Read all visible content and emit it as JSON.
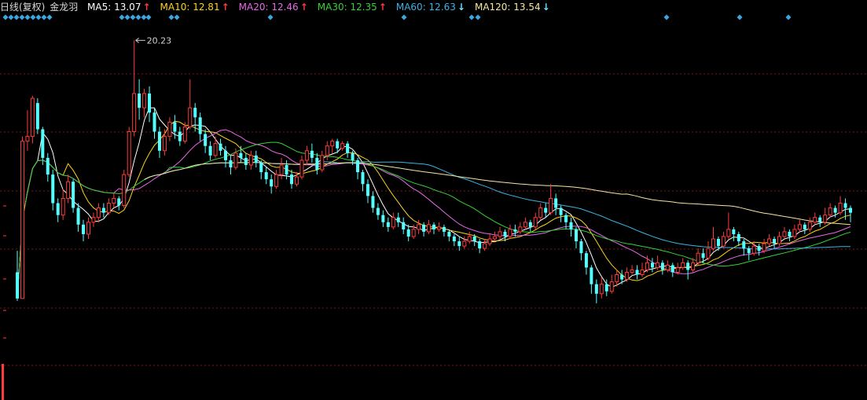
{
  "header": {
    "period_label": "日线(复权)",
    "stock_name": "金龙羽",
    "ma": [
      {
        "label": "MA5",
        "value": "13.07",
        "arrow": "↑",
        "arrow_color": "#ff3b3b",
        "color": "#ffffff"
      },
      {
        "label": "MA10",
        "value": "12.81",
        "arrow": "↑",
        "arrow_color": "#ff3b3b",
        "color": "#ffd21a"
      },
      {
        "label": "MA20",
        "value": "12.46",
        "arrow": "↑",
        "arrow_color": "#ff3b3b",
        "color": "#e868e8"
      },
      {
        "label": "MA30",
        "value": "12.35",
        "arrow": "↑",
        "arrow_color": "#ff3b3b",
        "color": "#36d236"
      },
      {
        "label": "MA60",
        "value": "12.63",
        "arrow": "↓",
        "arrow_color": "#66e0ff",
        "color": "#39b4e6"
      },
      {
        "label": "MA120",
        "value": "13.54",
        "arrow": "↓",
        "arrow_color": "#66e0ff",
        "color": "#f5e6a0"
      }
    ]
  },
  "colors": {
    "up": "#ff3b3b",
    "down": "#54ffff",
    "grid": "#7a1a1a",
    "marker": "#3aa7e0"
  },
  "chart_data": {
    "type": "candlestick",
    "annotation": {
      "text": "20.23",
      "value": 20.23
    },
    "ylim": [
      8.9,
      21.0
    ],
    "grid": true,
    "candles": [
      [
        10.5,
        9.4,
        11.4,
        9.3
      ],
      [
        9.4,
        16.0,
        16.2,
        9.4
      ],
      [
        16.0,
        16.2,
        17.3,
        15.6
      ],
      [
        16.2,
        17.8,
        17.9,
        15.9
      ],
      [
        17.6,
        16.5,
        17.8,
        16.3
      ],
      [
        16.5,
        15.3,
        16.6,
        15.0
      ],
      [
        15.3,
        14.6,
        15.5,
        14.3
      ],
      [
        14.6,
        13.4,
        14.8,
        13.1
      ],
      [
        13.4,
        12.9,
        13.6,
        12.6
      ],
      [
        12.9,
        13.6,
        14.0,
        12.7
      ],
      [
        13.6,
        14.3,
        14.6,
        13.4
      ],
      [
        14.3,
        13.2,
        14.4,
        13.0
      ],
      [
        13.2,
        12.5,
        13.4,
        12.2
      ],
      [
        12.5,
        12.1,
        12.7,
        11.8
      ],
      [
        12.1,
        12.6,
        12.8,
        11.9
      ],
      [
        12.6,
        12.8,
        13.0,
        12.4
      ],
      [
        12.8,
        13.2,
        13.4,
        12.6
      ],
      [
        13.2,
        13.0,
        13.4,
        12.8
      ],
      [
        13.0,
        13.4,
        13.6,
        12.9
      ],
      [
        13.4,
        13.6,
        13.8,
        13.2
      ],
      [
        13.6,
        13.3,
        13.7,
        13.1
      ],
      [
        13.3,
        14.6,
        14.8,
        13.2
      ],
      [
        14.6,
        16.4,
        16.6,
        14.5
      ],
      [
        16.4,
        18.0,
        20.23,
        16.2
      ],
      [
        18.0,
        17.4,
        18.6,
        16.9
      ],
      [
        17.4,
        18.0,
        18.2,
        17.0
      ],
      [
        18.0,
        17.2,
        18.3,
        16.8
      ],
      [
        17.2,
        16.4,
        17.4,
        16.1
      ],
      [
        16.4,
        15.6,
        16.6,
        15.3
      ],
      [
        15.6,
        16.2,
        16.5,
        15.4
      ],
      [
        16.2,
        16.8,
        17.0,
        16.0
      ],
      [
        16.8,
        16.4,
        17.1,
        16.1
      ],
      [
        16.4,
        16.0,
        16.6,
        15.8
      ],
      [
        16.0,
        16.6,
        16.8,
        15.9
      ],
      [
        16.6,
        17.4,
        18.6,
        16.5
      ],
      [
        17.4,
        17.0,
        17.6,
        16.4
      ],
      [
        17.0,
        16.3,
        17.2,
        16.0
      ],
      [
        16.3,
        15.8,
        16.5,
        15.5
      ],
      [
        15.8,
        15.4,
        16.0,
        15.2
      ],
      [
        15.4,
        15.9,
        16.2,
        15.3
      ],
      [
        15.9,
        15.6,
        16.1,
        15.4
      ],
      [
        15.6,
        15.2,
        15.8,
        14.9
      ],
      [
        15.2,
        14.9,
        15.4,
        14.6
      ],
      [
        14.9,
        15.5,
        15.7,
        14.8
      ],
      [
        15.5,
        15.3,
        15.8,
        15.1
      ],
      [
        15.3,
        15.0,
        15.5,
        14.8
      ],
      [
        15.0,
        15.4,
        15.6,
        14.8
      ],
      [
        15.4,
        15.1,
        15.6,
        14.9
      ],
      [
        15.1,
        14.7,
        15.2,
        14.4
      ],
      [
        14.7,
        14.4,
        14.9,
        14.2
      ],
      [
        14.4,
        14.1,
        14.6,
        13.8
      ],
      [
        14.1,
        14.6,
        14.8,
        14.0
      ],
      [
        14.6,
        15.0,
        15.3,
        14.4
      ],
      [
        15.0,
        14.6,
        15.2,
        14.4
      ],
      [
        14.6,
        14.2,
        14.8,
        14.0
      ],
      [
        14.2,
        14.5,
        14.7,
        14.1
      ],
      [
        14.5,
        15.2,
        15.4,
        14.4
      ],
      [
        15.2,
        15.6,
        15.8,
        15.0
      ],
      [
        15.6,
        15.3,
        15.9,
        15.1
      ],
      [
        15.3,
        14.8,
        15.5,
        14.6
      ],
      [
        14.8,
        15.4,
        15.6,
        14.7
      ],
      [
        15.4,
        15.8,
        16.0,
        15.2
      ],
      [
        15.8,
        16.0,
        16.1,
        15.5
      ],
      [
        16.0,
        15.7,
        16.1,
        15.5
      ],
      [
        15.7,
        15.9,
        16.0,
        15.6
      ],
      [
        15.9,
        15.5,
        16.0,
        15.3
      ],
      [
        15.5,
        15.2,
        15.6,
        15.0
      ],
      [
        15.2,
        14.7,
        15.3,
        14.4
      ],
      [
        14.7,
        14.2,
        14.8,
        13.9
      ],
      [
        14.2,
        13.7,
        14.4,
        13.4
      ],
      [
        13.7,
        13.2,
        13.9,
        13.0
      ],
      [
        13.2,
        12.9,
        13.4,
        12.7
      ],
      [
        12.9,
        12.6,
        13.1,
        12.4
      ],
      [
        12.6,
        12.4,
        12.8,
        12.2
      ],
      [
        12.4,
        12.8,
        13.0,
        12.3
      ],
      [
        12.8,
        12.6,
        13.0,
        12.4
      ],
      [
        12.6,
        12.3,
        12.8,
        12.1
      ],
      [
        12.3,
        12.0,
        12.5,
        11.8
      ],
      [
        12.0,
        12.3,
        12.5,
        11.9
      ],
      [
        12.3,
        12.5,
        12.7,
        12.1
      ],
      [
        12.5,
        12.2,
        12.6,
        12.0
      ],
      [
        12.2,
        12.5,
        12.7,
        12.1
      ],
      [
        12.5,
        12.3,
        12.6,
        12.1
      ],
      [
        12.3,
        12.4,
        12.6,
        12.2
      ],
      [
        12.4,
        12.2,
        12.5,
        12.0
      ],
      [
        12.2,
        12.0,
        12.3,
        11.8
      ],
      [
        12.0,
        11.8,
        12.1,
        11.6
      ],
      [
        11.8,
        11.6,
        12.0,
        11.4
      ],
      [
        11.6,
        11.8,
        12.0,
        11.5
      ],
      [
        11.8,
        12.0,
        12.2,
        11.7
      ],
      [
        12.0,
        11.8,
        12.1,
        11.6
      ],
      [
        11.8,
        11.5,
        11.9,
        11.3
      ],
      [
        11.5,
        11.7,
        11.9,
        11.4
      ],
      [
        11.7,
        11.9,
        12.1,
        11.6
      ],
      [
        11.9,
        12.0,
        12.2,
        11.8
      ],
      [
        12.0,
        12.2,
        12.4,
        11.9
      ],
      [
        12.2,
        12.0,
        12.3,
        11.8
      ],
      [
        12.0,
        12.3,
        12.5,
        11.9
      ],
      [
        12.3,
        12.2,
        12.5,
        12.0
      ],
      [
        12.2,
        12.4,
        12.6,
        12.1
      ],
      [
        12.4,
        12.6,
        12.8,
        12.3
      ],
      [
        12.6,
        12.4,
        12.7,
        12.2
      ],
      [
        12.4,
        12.8,
        13.0,
        12.3
      ],
      [
        12.8,
        13.2,
        13.4,
        12.7
      ],
      [
        13.2,
        13.0,
        13.4,
        12.8
      ],
      [
        13.0,
        13.6,
        14.2,
        12.9
      ],
      [
        13.6,
        13.2,
        13.8,
        12.9
      ],
      [
        13.2,
        12.9,
        13.3,
        12.6
      ],
      [
        12.9,
        12.6,
        13.0,
        12.3
      ],
      [
        12.6,
        12.3,
        12.8,
        12.0
      ],
      [
        12.3,
        11.8,
        12.4,
        11.5
      ],
      [
        11.8,
        11.3,
        11.9,
        11.0
      ],
      [
        11.3,
        10.7,
        11.4,
        10.4
      ],
      [
        10.7,
        10.0,
        10.8,
        9.6
      ],
      [
        10.0,
        9.6,
        10.2,
        9.2
      ],
      [
        9.6,
        10.0,
        10.3,
        9.4
      ],
      [
        10.0,
        9.7,
        10.2,
        9.5
      ],
      [
        9.7,
        10.1,
        10.4,
        9.6
      ],
      [
        10.1,
        10.4,
        10.6,
        9.9
      ],
      [
        10.4,
        10.2,
        10.6,
        10.0
      ],
      [
        10.2,
        10.5,
        10.7,
        10.1
      ],
      [
        10.5,
        10.6,
        10.8,
        10.4
      ],
      [
        10.6,
        10.4,
        10.8,
        10.2
      ],
      [
        10.4,
        10.6,
        10.9,
        10.3
      ],
      [
        10.6,
        10.9,
        11.2,
        10.5
      ],
      [
        10.9,
        10.7,
        11.1,
        10.5
      ],
      [
        10.7,
        10.9,
        11.2,
        10.6
      ],
      [
        10.9,
        10.6,
        11.0,
        10.4
      ],
      [
        10.6,
        10.8,
        11.0,
        10.5
      ],
      [
        10.8,
        10.5,
        10.9,
        10.3
      ],
      [
        10.5,
        10.7,
        10.9,
        10.4
      ],
      [
        10.7,
        10.9,
        11.1,
        10.6
      ],
      [
        10.9,
        10.6,
        11.0,
        10.2
      ],
      [
        10.6,
        10.9,
        11.1,
        10.5
      ],
      [
        10.9,
        11.3,
        11.5,
        10.8
      ],
      [
        11.3,
        11.1,
        11.5,
        10.9
      ],
      [
        11.1,
        11.5,
        11.8,
        11.0
      ],
      [
        11.5,
        11.9,
        12.4,
        11.4
      ],
      [
        11.9,
        11.6,
        12.0,
        11.4
      ],
      [
        11.6,
        12.0,
        12.2,
        11.5
      ],
      [
        12.0,
        12.3,
        13.0,
        11.9
      ],
      [
        12.3,
        12.1,
        12.4,
        11.8
      ],
      [
        12.1,
        11.8,
        12.2,
        11.6
      ],
      [
        11.8,
        11.5,
        11.9,
        11.2
      ],
      [
        11.5,
        11.3,
        11.6,
        11.0
      ],
      [
        11.3,
        11.6,
        11.8,
        11.2
      ],
      [
        11.6,
        11.4,
        11.7,
        11.2
      ],
      [
        11.4,
        11.7,
        11.9,
        11.3
      ],
      [
        11.7,
        11.9,
        12.1,
        11.6
      ],
      [
        11.9,
        11.7,
        12.0,
        11.5
      ],
      [
        11.7,
        12.0,
        12.2,
        11.6
      ],
      [
        12.0,
        12.2,
        12.4,
        11.9
      ],
      [
        12.2,
        12.0,
        12.3,
        11.8
      ],
      [
        12.0,
        12.3,
        12.5,
        11.9
      ],
      [
        12.3,
        12.5,
        12.7,
        12.2
      ],
      [
        12.5,
        12.3,
        12.6,
        12.1
      ],
      [
        12.3,
        12.6,
        12.8,
        12.2
      ],
      [
        12.6,
        12.8,
        13.0,
        12.5
      ],
      [
        12.8,
        12.6,
        12.9,
        12.4
      ],
      [
        12.6,
        12.9,
        13.2,
        12.5
      ],
      [
        12.9,
        13.2,
        13.4,
        12.8
      ],
      [
        13.2,
        13.0,
        13.3,
        12.8
      ],
      [
        13.0,
        13.4,
        13.7,
        12.9
      ],
      [
        13.4,
        13.2,
        13.6,
        12.7
      ],
      [
        13.2,
        13.0,
        13.3,
        12.6
      ]
    ]
  }
}
